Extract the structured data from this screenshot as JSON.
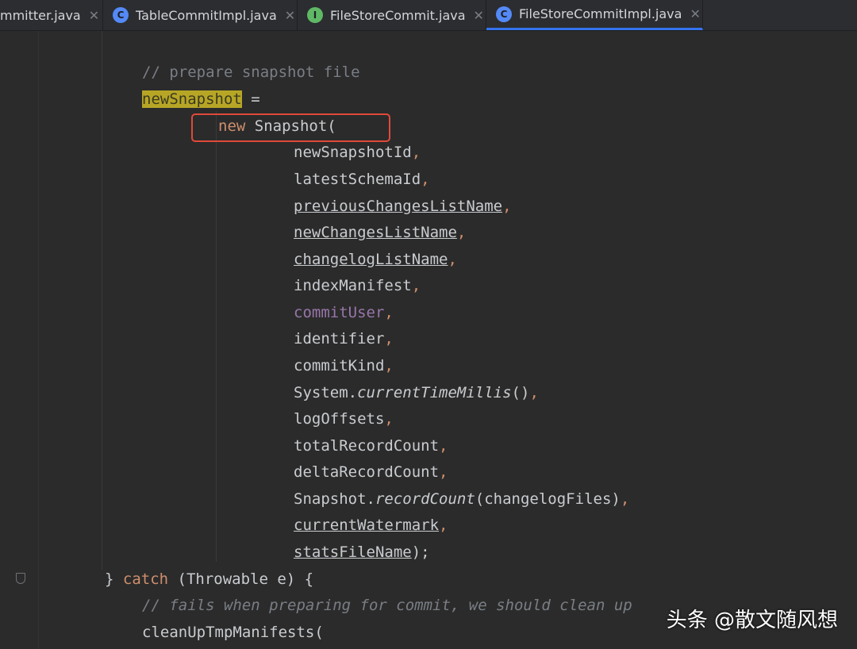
{
  "tabs": [
    {
      "label": "mmitter.java",
      "icon": "none",
      "active": false
    },
    {
      "label": "TableCommitImpl.java",
      "icon": "class-icon",
      "active": false
    },
    {
      "label": "FileStoreCommit.java",
      "icon": "interface-icon",
      "active": false
    },
    {
      "label": "FileStoreCommitImpl.java",
      "icon": "class-icon",
      "active": true
    }
  ],
  "tab_icons": {
    "class": "C",
    "interface": "I",
    "close": "✕"
  },
  "code": {
    "comment1": "// prepare snapshot file",
    "assign_var": "newSnapshot",
    "assign_op": " =",
    "new_kw": "new",
    "new_type": " Snapshot(",
    "args": {
      "a1": "newSnapshotId",
      "a2": "latestSchemaId",
      "a3": "previousChangesListName",
      "a4": "newChangesListName",
      "a5": "changelogListName",
      "a6": "indexManifest",
      "a7": "commitUser",
      "a8": "identifier",
      "a9": "commitKind",
      "a10_obj": "System.",
      "a10_method": "currentTimeMillis",
      "a10_tail": "()",
      "a11": "logOffsets",
      "a12": "totalRecordCount",
      "a13": "deltaRecordCount",
      "a14_obj": "Snapshot.",
      "a14_method": "recordCount",
      "a14_tail": "(changelogFiles)",
      "a15": "currentWatermark",
      "a16": "statsFileName",
      "a16_tail": ");"
    },
    "comma": ",",
    "catch_brace": "} ",
    "catch_kw": "catch",
    "catch_rest": " (Throwable e) {",
    "comment2": "// fails when preparing for commit, we should clean up",
    "cleanup": "cleanUpTmpManifests("
  },
  "watermark": "头条 @散文随风想",
  "colors": {
    "keyword": "#cf8e6d",
    "comment": "#7a7e85",
    "field": "#9876aa",
    "highlight": "#b7a626",
    "annotation_box": "#e04a3a",
    "active_tab": "#3574f0"
  }
}
